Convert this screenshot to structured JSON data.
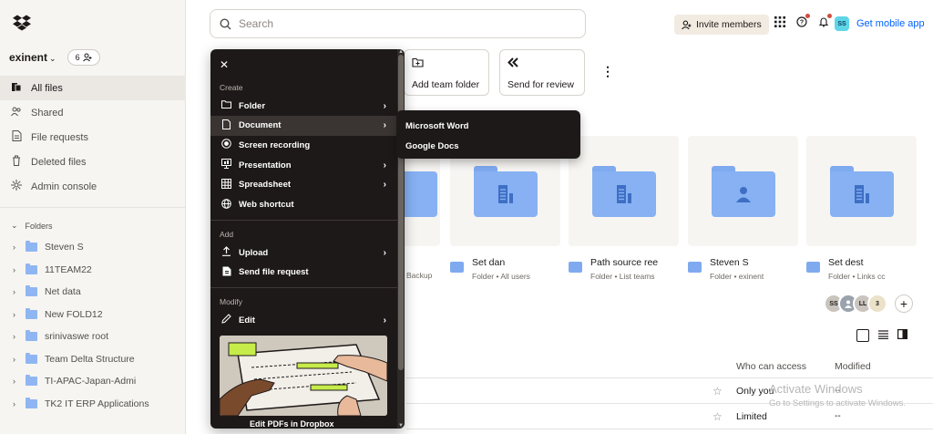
{
  "sidebar": {
    "team": {
      "name": "exinent",
      "member_count": "6"
    },
    "nav": [
      {
        "label": "All files",
        "icon": "files-icon",
        "active": true
      },
      {
        "label": "Shared",
        "icon": "shared-icon",
        "active": false
      },
      {
        "label": "File requests",
        "icon": "file-request-icon",
        "active": false
      },
      {
        "label": "Deleted files",
        "icon": "trash-icon",
        "active": false
      },
      {
        "label": "Admin console",
        "icon": "admin-icon",
        "active": false
      }
    ],
    "folders_heading": "Folders",
    "folders": [
      "Steven S",
      "11TEAM22",
      "Net data",
      "New FOLD12",
      "srinivaswe root",
      "Team Delta Structure",
      "TI-APAC-Japan-Admi",
      "TK2 IT ERP Applications"
    ]
  },
  "header": {
    "search_placeholder": "Search",
    "invite_label": "Invite members",
    "user_initials": "SS",
    "mobile_link": "Get mobile app"
  },
  "actions": {
    "add_team_folder": "Add team folder",
    "send_for_review": "Send for review"
  },
  "tiles": [
    {
      "name": "Set dan",
      "sub": "Folder • All users",
      "glyph": "doc"
    },
    {
      "name": "Path source ree",
      "sub": "Folder • List teams",
      "glyph": "doc"
    },
    {
      "name": "Steven S",
      "sub": "Folder • exinent",
      "glyph": "person"
    },
    {
      "name": "Set dest",
      "sub": "Folder • Links cc",
      "glyph": "doc"
    }
  ],
  "backup_label": "Backup",
  "members": {
    "avatars": [
      {
        "initials": "SS",
        "bg": "#c9c4bd",
        "fg": "#1e1919"
      },
      {
        "initials": "",
        "bg": "#9aa3ad",
        "fg": "#ffffff"
      },
      {
        "initials": "LL",
        "bg": "#c9c4bd",
        "fg": "#1e1919"
      }
    ],
    "more_count": "3"
  },
  "table": {
    "headers": {
      "access": "Who can access",
      "modified": "Modified"
    },
    "rows": [
      {
        "access": "Only you",
        "modified": "--"
      },
      {
        "access": "Limited",
        "modified": "--"
      }
    ]
  },
  "watermark": {
    "title": "Activate Windows",
    "subtitle": "Go to Settings to activate Windows."
  },
  "create_menu": {
    "create_heading": "Create",
    "create_items": [
      {
        "label": "Folder",
        "icon": "folder-icon",
        "submenu": true
      },
      {
        "label": "Document",
        "icon": "document-icon",
        "submenu": true
      },
      {
        "label": "Screen recording",
        "icon": "record-icon",
        "submenu": false
      },
      {
        "label": "Presentation",
        "icon": "presentation-icon",
        "submenu": true
      },
      {
        "label": "Spreadsheet",
        "icon": "spreadsheet-icon",
        "submenu": true
      },
      {
        "label": "Web shortcut",
        "icon": "globe-icon",
        "submenu": false
      }
    ],
    "add_heading": "Add",
    "add_items": [
      {
        "label": "Upload",
        "icon": "upload-icon",
        "submenu": true
      },
      {
        "label": "Send file request",
        "icon": "file-request-icon",
        "submenu": false
      }
    ],
    "modify_heading": "Modify",
    "modify_items": [
      {
        "label": "Edit",
        "icon": "edit-icon",
        "submenu": true
      }
    ],
    "promo_label": "Edit PDFs in Dropbox"
  },
  "document_submenu": [
    "Microsoft Word",
    "Google Docs"
  ],
  "colors": {
    "accent": "#0061fe",
    "folder": "#87b1f3",
    "menu_bg": "#1e1919",
    "sidebar_bg": "#f7f5f2"
  }
}
